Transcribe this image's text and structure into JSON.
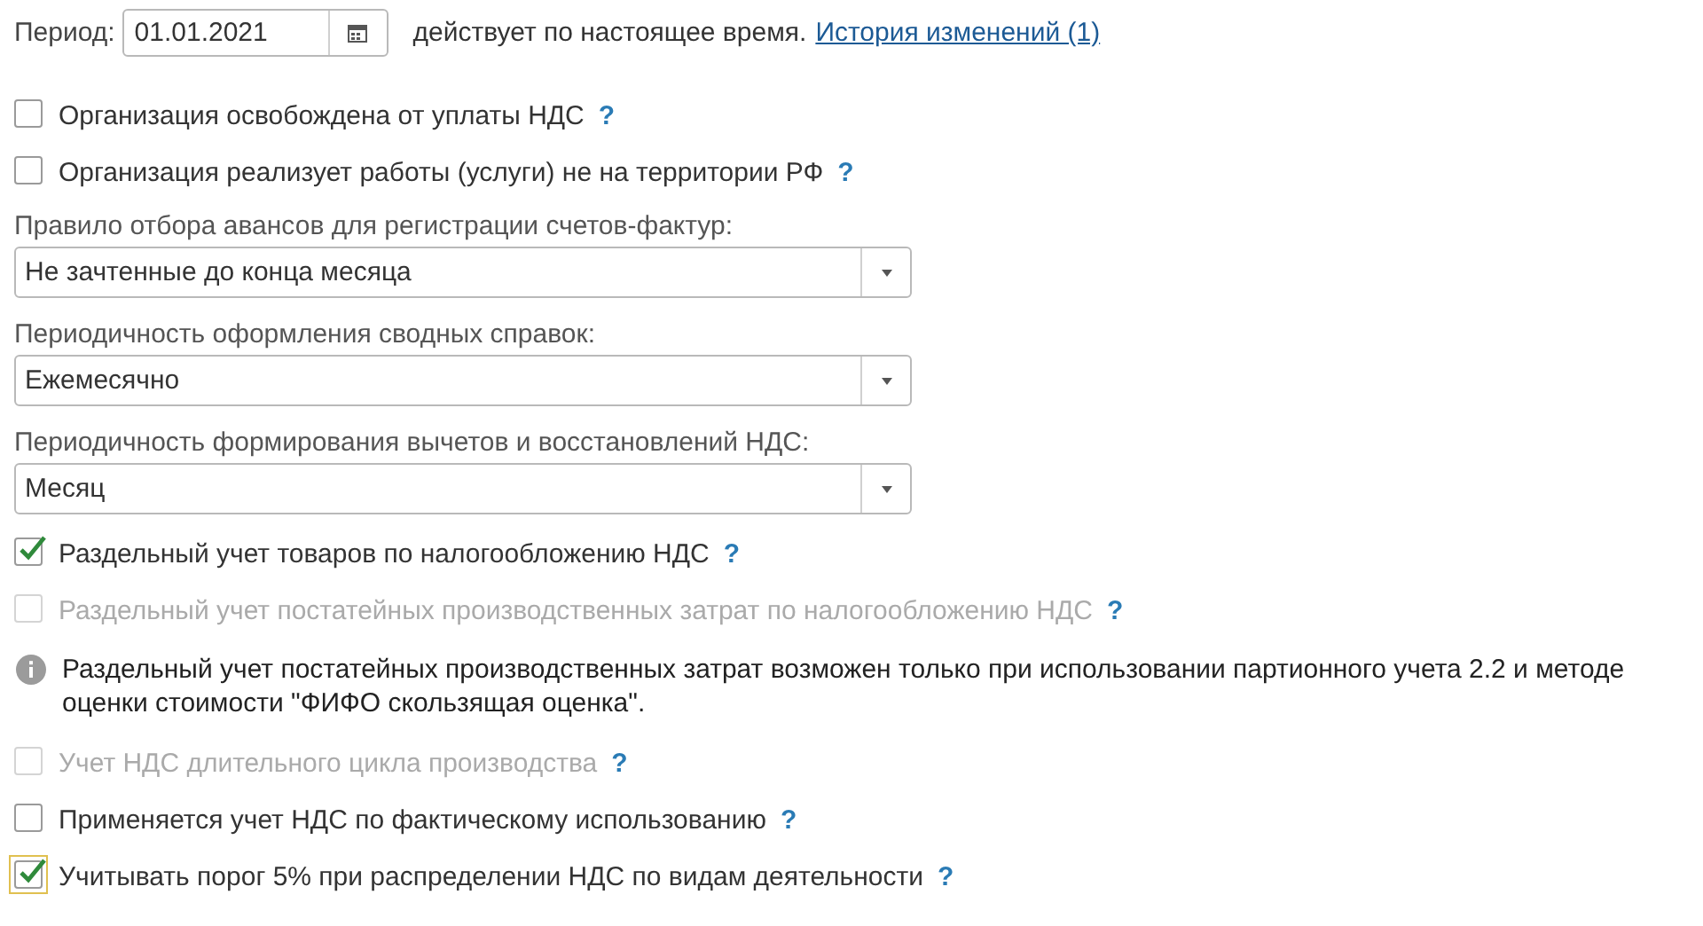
{
  "period": {
    "label": "Период:",
    "value": "01.01.2021",
    "note": "действует по настоящее время.",
    "link": "История изменений (1)"
  },
  "items": [
    {
      "kind": "checkbox",
      "label": "Организация освобождена от уплаты НДС",
      "help": "?",
      "checked": false,
      "disabled": false,
      "focused": false
    },
    {
      "kind": "checkbox",
      "label": "Организация реализует работы (услуги) не на территории РФ",
      "help": "?",
      "checked": false,
      "disabled": false,
      "focused": false
    },
    {
      "kind": "select",
      "label": "Правило отбора авансов для регистрации счетов-фактур:",
      "value": "Не зачтенные до конца месяца"
    },
    {
      "kind": "select",
      "label": "Периодичность оформления сводных справок:",
      "value": "Ежемесячно"
    },
    {
      "kind": "select",
      "label": "Периодичность формирования вычетов и восстановлений НДС:",
      "value": "Месяц"
    },
    {
      "kind": "checkbox",
      "label": "Раздельный учет товаров по налогообложению НДС",
      "help": "?",
      "checked": true,
      "disabled": false,
      "focused": false
    },
    {
      "kind": "checkbox",
      "label": "Раздельный учет постатейных производственных затрат по налогообложению НДС",
      "help": "?",
      "checked": false,
      "disabled": true,
      "focused": false
    },
    {
      "kind": "info",
      "text": "Раздельный учет постатейных производственных затрат возможен только при использовании партионного учета 2.2 и методе оценки стоимости \"ФИФО скользящая оценка\"."
    },
    {
      "kind": "checkbox",
      "label": "Учет НДС длительного цикла производства",
      "help": "?",
      "checked": false,
      "disabled": true,
      "focused": false
    },
    {
      "kind": "checkbox",
      "label": "Применяется учет НДС по фактическому использованию",
      "help": "?",
      "checked": false,
      "disabled": false,
      "focused": false
    },
    {
      "kind": "checkbox",
      "label": "Учитывать порог 5% при распределении НДС по видам деятельности",
      "help": "?",
      "checked": true,
      "disabled": false,
      "focused": true
    }
  ]
}
